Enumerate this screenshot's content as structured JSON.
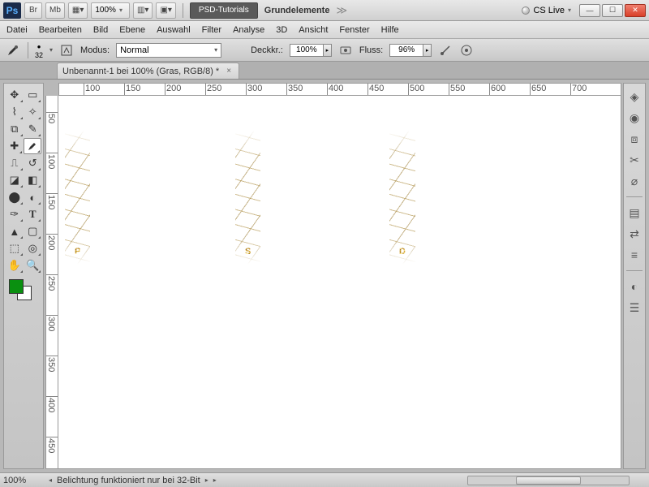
{
  "topbar": {
    "logo": "Ps",
    "br": "Br",
    "mb": "Mb",
    "zoom": "100%",
    "workspace_active": "PSD-Tutorials",
    "workspace_other": "Grundelemente",
    "cslive": "CS Live"
  },
  "menu": [
    "Datei",
    "Bearbeiten",
    "Bild",
    "Ebene",
    "Auswahl",
    "Filter",
    "Analyse",
    "3D",
    "Ansicht",
    "Fenster",
    "Hilfe"
  ],
  "options": {
    "brush_size": "32",
    "modus_label": "Modus:",
    "modus_value": "Normal",
    "deckkr_label": "Deckkr.:",
    "deckkr_value": "100%",
    "fluss_label": "Fluss:",
    "fluss_value": "96%"
  },
  "tab": {
    "title": "Unbenannt-1 bei 100% (Gras, RGB/8) *"
  },
  "ruler_h": [
    "100",
    "150",
    "200",
    "250",
    "300",
    "350",
    "400",
    "450",
    "500",
    "550",
    "600",
    "650",
    "700"
  ],
  "ruler_v": [
    "50",
    "100",
    "150",
    "200",
    "250",
    "300",
    "350",
    "400",
    "450"
  ],
  "canvas_text": [
    "P",
    "S",
    "D"
  ],
  "swatch": {
    "fg": "#0a9010",
    "bg": "#ffffff"
  },
  "status": {
    "zoom": "100%",
    "msg": "Belichtung funktioniert nur bei 32-Bit"
  }
}
